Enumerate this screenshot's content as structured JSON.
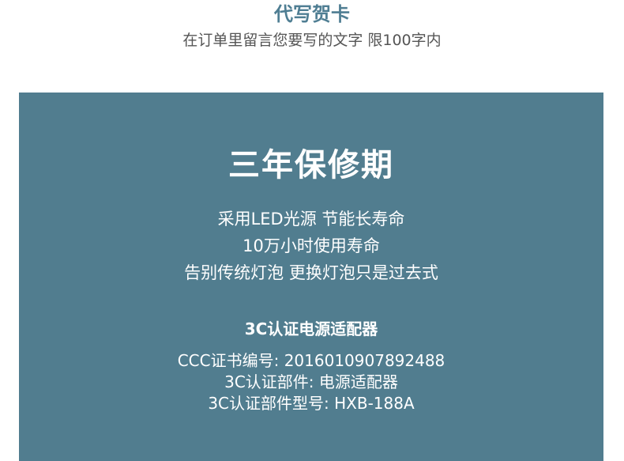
{
  "header": {
    "title": "代写贺卡",
    "subtitle": "在订单里留言您要写的文字 限100字内"
  },
  "panel": {
    "title": "三年保修期",
    "features": [
      "采用LED光源 节能长寿命",
      "10万小时使用寿命",
      "告别传统灯泡 更换灯泡只是过去式"
    ],
    "adapter_title": "3C认证电源适配器",
    "specs": [
      "CCC证书编号: 2016010907892488",
      "3C认证部件: 电源适配器",
      "3C认证部件型号: HXB-188A"
    ],
    "background_color": "#517d8f"
  }
}
